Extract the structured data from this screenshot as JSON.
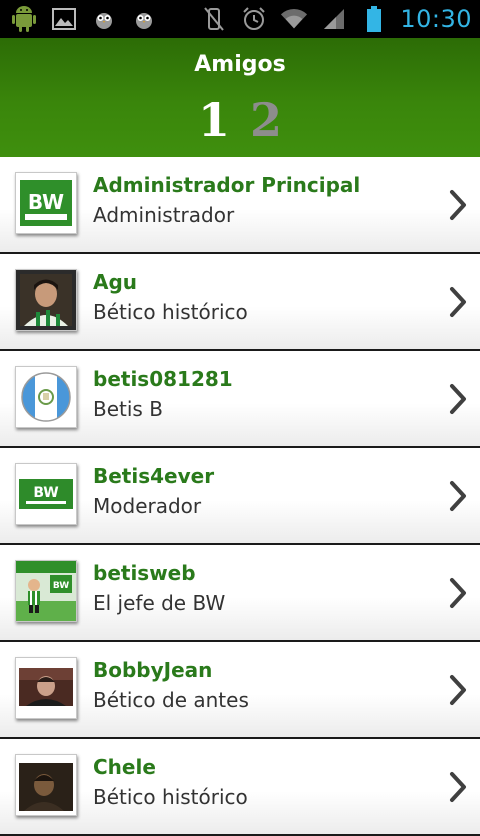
{
  "status_bar": {
    "time": "10:30",
    "left_icons": [
      "android-icon",
      "image-icon",
      "owl-icon",
      "owl-icon"
    ],
    "right_icons": [
      "vibrate-off-icon",
      "alarm-icon",
      "wifi-icon",
      "signal-icon",
      "battery-icon"
    ],
    "accent": "#33b5e5"
  },
  "header": {
    "title": "Amigos",
    "pages": [
      {
        "label": "1",
        "active": true
      },
      {
        "label": "2",
        "active": false
      }
    ],
    "color": "#3a860b"
  },
  "friends": [
    {
      "name": "Administrador Principal",
      "role": "Administrador",
      "avatar": "betisweb-logo-avatar"
    },
    {
      "name": "Agu",
      "role": "Bético histórico",
      "avatar": "player-photo-avatar"
    },
    {
      "name": "betis081281",
      "role": "Betis B",
      "avatar": "guatemala-flag-avatar"
    },
    {
      "name": "Betis4ever",
      "role": "Moderador",
      "avatar": "bw-logo-avatar"
    },
    {
      "name": "betisweb",
      "role": "El jefe de BW",
      "avatar": "bw-cartoon-avatar"
    },
    {
      "name": "BobbyJean",
      "role": "Bético de antes",
      "avatar": "man-photo-avatar"
    },
    {
      "name": "Chele",
      "role": "Bético histórico",
      "avatar": "dark-photo-avatar"
    }
  ],
  "colors": {
    "name_text": "#2a7a1b",
    "role_text": "#333333",
    "divider": "#1a1a1a"
  }
}
